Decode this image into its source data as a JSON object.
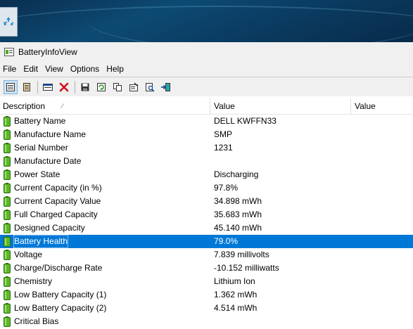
{
  "window": {
    "title": "BatteryInfoView"
  },
  "menu": [
    "File",
    "Edit",
    "View",
    "Options",
    "Help"
  ],
  "toolbar": [
    "html-report-icon",
    "text-report-icon",
    "properties-window-icon",
    "delete-icon",
    "save-icon",
    "refresh-icon",
    "copy-icon",
    "properties-icon",
    "find-icon",
    "exit-icon"
  ],
  "columns": {
    "description": "Description",
    "value": "Value",
    "value2": "Value"
  },
  "rows": [
    {
      "description": "Battery Name",
      "value": "DELL KWFFN33"
    },
    {
      "description": "Manufacture Name",
      "value": "SMP"
    },
    {
      "description": "Serial Number",
      "value": "1231"
    },
    {
      "description": "Manufacture Date",
      "value": ""
    },
    {
      "description": "Power State",
      "value": "Discharging"
    },
    {
      "description": "Current Capacity (in %)",
      "value": "97.8%"
    },
    {
      "description": "Current Capacity Value",
      "value": "34.898 mWh"
    },
    {
      "description": "Full Charged Capacity",
      "value": "35.683 mWh"
    },
    {
      "description": "Designed Capacity",
      "value": "45.140 mWh"
    },
    {
      "description": "Battery Health",
      "value": "79.0%",
      "selected": true
    },
    {
      "description": "Voltage",
      "value": "7.839 millivolts"
    },
    {
      "description": "Charge/Discharge Rate",
      "value": "-10.152 milliwatts"
    },
    {
      "description": "Chemistry",
      "value": "Lithium Ion"
    },
    {
      "description": "Low Battery Capacity (1)",
      "value": "1.362 mWh"
    },
    {
      "description": "Low Battery Capacity (2)",
      "value": "4.514 mWh"
    },
    {
      "description": "Critical Bias",
      "value": ""
    }
  ],
  "colors": {
    "selection": "#0078d7",
    "battery_green": "#4caf1e",
    "chrome": "#f0f0f0"
  }
}
